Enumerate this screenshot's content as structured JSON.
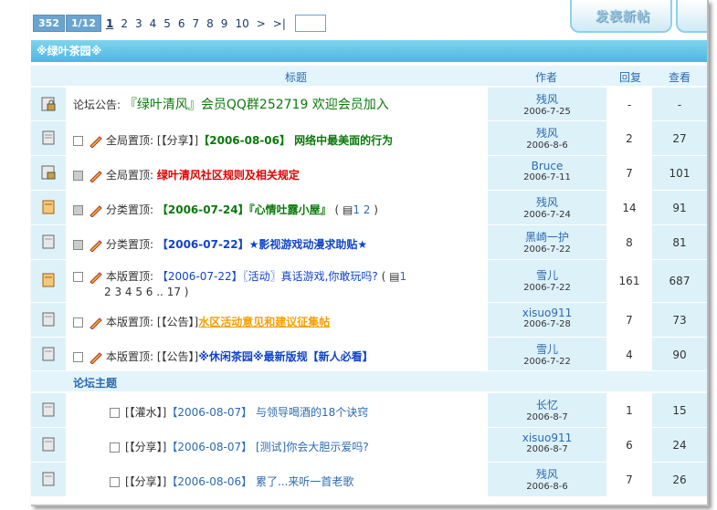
{
  "pager": {
    "count": "352",
    "page_of": "1/12",
    "pages": [
      "1",
      "2",
      "3",
      "4",
      "5",
      "6",
      "7",
      "8",
      "9",
      "10"
    ],
    "next": ">",
    "last": ">|"
  },
  "new_post_label": "发表新帖",
  "forum_name": "※绿叶茶园※",
  "columns": {
    "title": "标题",
    "author": "作者",
    "replies": "回复",
    "views": "查看"
  },
  "announcement": {
    "prefix": "论坛公告:",
    "text": "『绿叶清风』会员QQ群252719 欢迎会员加入",
    "author": "残风",
    "date": "2006-7-25",
    "replies": "-",
    "views": "-"
  },
  "pinned": [
    {
      "type": "全局置顶:",
      "tag": "[【分享】]",
      "title": "【2006-08-06】 网络中最美面的行为",
      "style": "green",
      "author": "残风",
      "date": "2006-8-6",
      "replies": "2",
      "views": "27"
    },
    {
      "type": "全局置顶:",
      "tag": "",
      "title": "绿叶清风社区规则及相关规定",
      "style": "red",
      "author": "Bruce",
      "date": "2006-7-11",
      "replies": "7",
      "views": "101"
    },
    {
      "type": "分类置顶:",
      "tag": "",
      "title": "【2006-07-24】『心情吐露小屋』",
      "style": "green",
      "pages_prefix": "( ",
      "pages": "1 2",
      "pages_suffix": ")",
      "author": "残风",
      "date": "2006-7-24",
      "replies": "14",
      "views": "91"
    },
    {
      "type": "分类置顶:",
      "tag": "",
      "title": "【2006-07-22】★影视游戏动漫求助贴★",
      "style": "blue",
      "author": "黑崎一护",
      "date": "2006-7-22",
      "replies": "8",
      "views": "81"
    },
    {
      "type": "本版置顶:",
      "tag": "",
      "title": "【2006-07-22】〖活动〗真话游戏,你敢玩吗?",
      "style": "plain",
      "pages_prefix": "( ",
      "pages": "1",
      "pages_line2": "2 3 4 5 6 .. 17 )",
      "author": "雪儿",
      "date": "2006-7-22",
      "replies": "161",
      "views": "687"
    },
    {
      "type": "本版置顶:",
      "tag": "[【公告】]",
      "title": "水区活动意见和建议征集帖",
      "style": "orange",
      "author": "xisuo911",
      "date": "2006-7-28",
      "replies": "7",
      "views": "73"
    },
    {
      "type": "本版置顶:",
      "tag": "[【公告】]",
      "title": "※休闲茶园※最新版规【新人必看】",
      "style": "blue",
      "author": "雪儿",
      "date": "2006-7-22",
      "replies": "4",
      "views": "90"
    }
  ],
  "section_label": "论坛主题",
  "topics": [
    {
      "tag": "[【灌水】]",
      "date_tag": "【2006-08-07】",
      "title": "与领导喝酒的18个诀窍",
      "author": "长忆",
      "date": "2006-8-7",
      "replies": "1",
      "views": "15"
    },
    {
      "tag": "[【分享】]",
      "date_tag": "【2006-08-07】",
      "title": "[测试]你会大胆示爱吗?",
      "author": "xisuo911",
      "date": "2006-8-7",
      "replies": "6",
      "views": "24"
    },
    {
      "tag": "[【分享】]",
      "date_tag": "【2006-08-06】",
      "title": "累了...来听一首老歌",
      "author": "残风",
      "date": "2006-8-6",
      "replies": "7",
      "views": "26"
    }
  ]
}
